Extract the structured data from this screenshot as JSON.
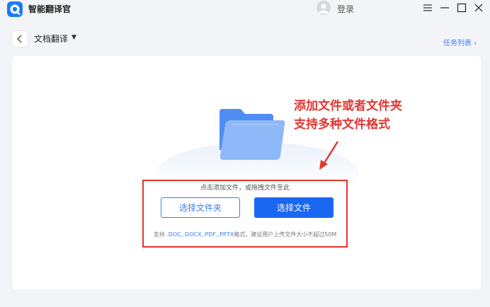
{
  "titlebar": {
    "app_name": "智能翻译官",
    "login_label": "登录"
  },
  "subheader": {
    "mode_title": "文档翻译",
    "task_list_label": "任务列表",
    "task_list_chevron": "›"
  },
  "upload": {
    "hint_top": "点击添加文件，或拖拽文件至此",
    "select_folder_label": "选择文件夹",
    "select_file_label": "选择文件",
    "support_prefix": "支持",
    "support_formats": ".DOC,.DOCX,.PDF,.PPTX",
    "support_suffix": "格式，建议用户上传文件大小不超过50M"
  },
  "annotation": {
    "line1": "添加文件或者文件夹",
    "line2": "支持多种文件格式"
  },
  "colors": {
    "accent": "#1a67f2",
    "annotation": "#e5342f"
  },
  "icons": [
    "app-logo-icon",
    "avatar-icon",
    "menu-icon",
    "minimize-icon",
    "maximize-icon",
    "close-icon",
    "back-arrow-icon",
    "dropdown-caret-icon",
    "folder-icon"
  ]
}
